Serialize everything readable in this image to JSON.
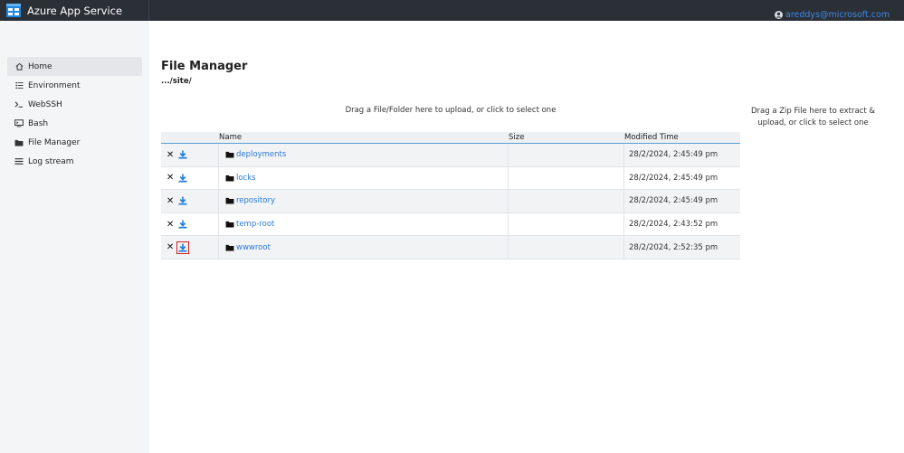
{
  "app": {
    "title": "Azure App Service",
    "user_email": "areddys@microsoft.com"
  },
  "sidebar": {
    "items": [
      {
        "label": "Home",
        "icon": "home-icon",
        "active": true
      },
      {
        "label": "Environment",
        "icon": "list-icon",
        "active": false
      },
      {
        "label": "WebSSH",
        "icon": "terminal-icon",
        "active": false
      },
      {
        "label": "Bash",
        "icon": "console-icon",
        "active": false
      },
      {
        "label": "File Manager",
        "icon": "folder-icon",
        "active": false
      },
      {
        "label": "Log stream",
        "icon": "stream-icon",
        "active": false
      }
    ]
  },
  "main": {
    "title": "File Manager",
    "path": ".../site/",
    "drop_folder_text": "Drag a File/Folder here to upload, or click to select one",
    "drop_zip_text": "Drag a Zip File here to extract & upload, or click to select one",
    "columns": {
      "name": "Name",
      "size": "Size",
      "modified": "Modified Time"
    },
    "rows": [
      {
        "name": "deployments",
        "size": "",
        "modified": "28/2/2024, 2:45:49 pm"
      },
      {
        "name": "locks",
        "size": "",
        "modified": "28/2/2024, 2:45:49 pm"
      },
      {
        "name": "repository",
        "size": "",
        "modified": "28/2/2024, 2:45:49 pm"
      },
      {
        "name": "temp-root",
        "size": "",
        "modified": "28/2/2024, 2:43:52 pm"
      },
      {
        "name": "wwwroot",
        "size": "",
        "modified": "28/2/2024, 2:52:35 pm"
      }
    ]
  },
  "colors": {
    "topbar": "#2b2f36",
    "accent": "#2a7ad9",
    "highlight": "#d62020"
  }
}
